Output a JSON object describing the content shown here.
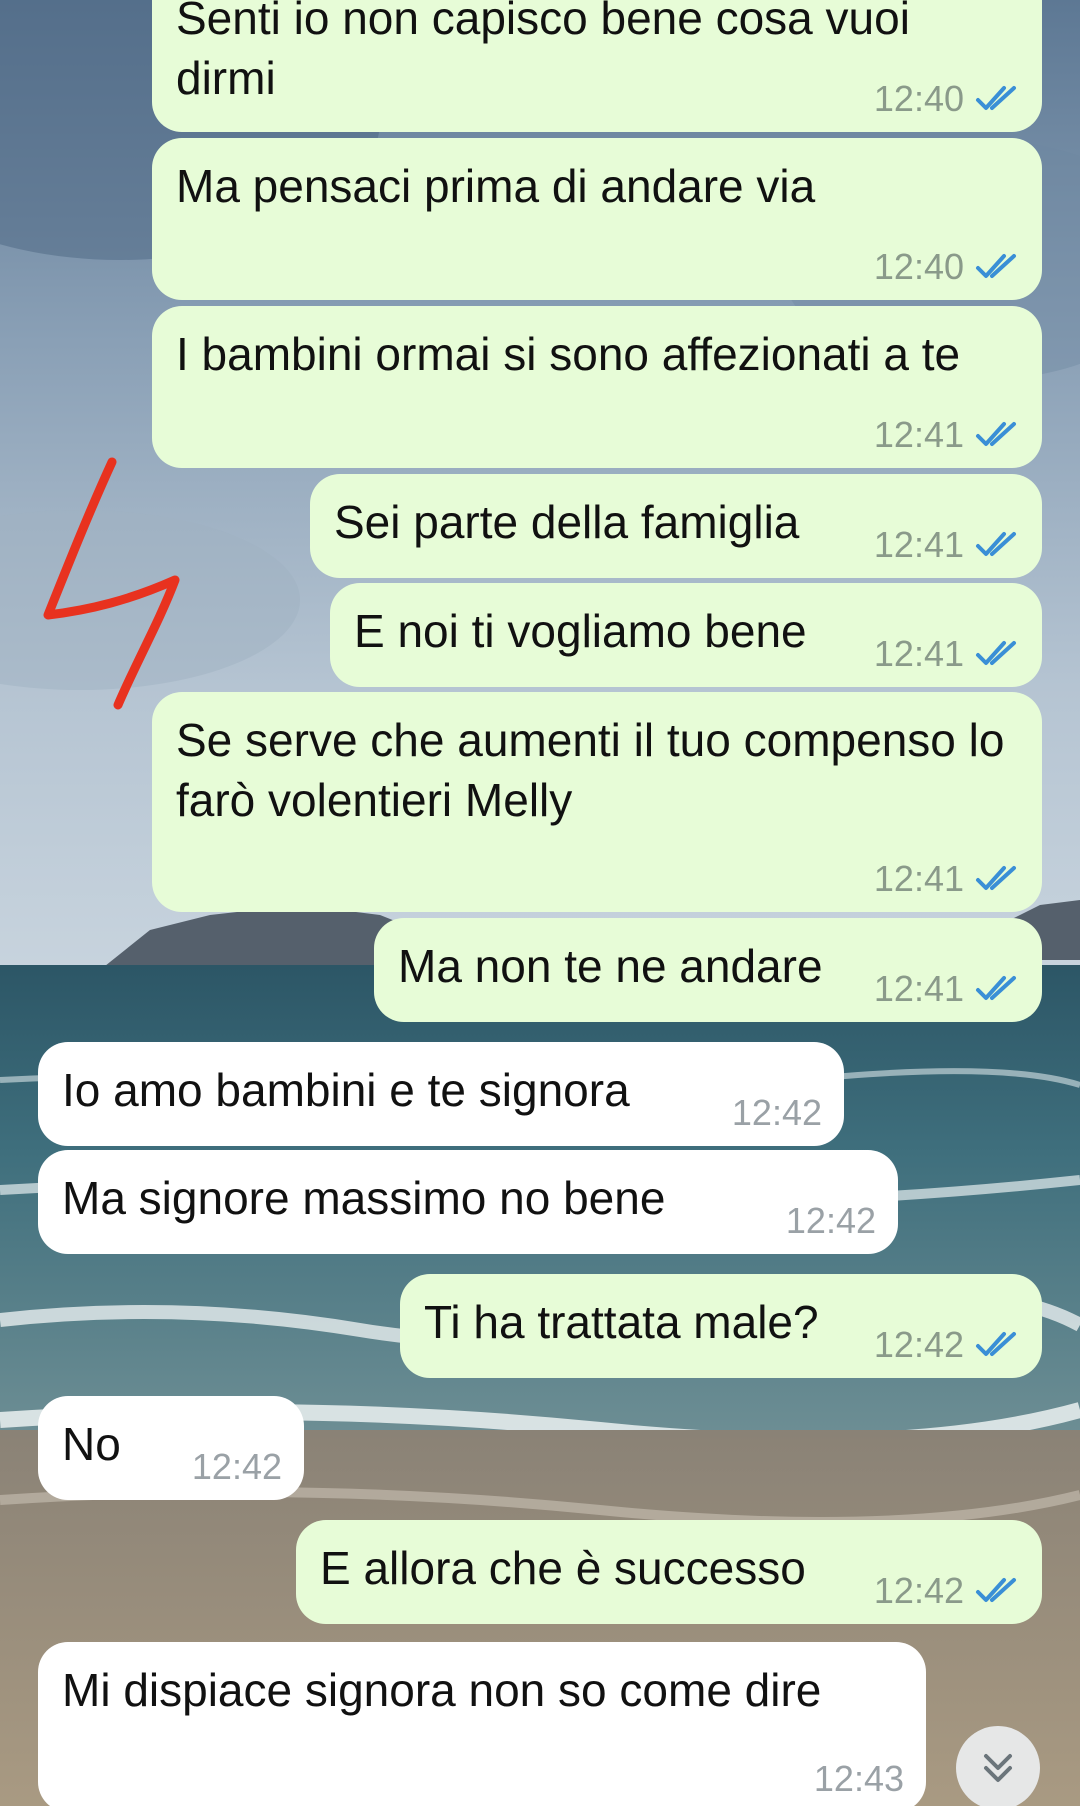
{
  "theme": {
    "outgoing_bubble": "#e7fcd7",
    "incoming_bubble": "#ffffff",
    "tick_color": "#3a8fd6",
    "annotation_color": "#e8321f"
  },
  "annotation": {
    "glyph": "4"
  },
  "messages": [
    {
      "dir": "out",
      "text": "Senti io non capisco bene cosa vuoi dirmi",
      "time": "12:40",
      "ticks": "double-check-icon"
    },
    {
      "dir": "out",
      "text": "Ma pensaci prima di andare via",
      "time": "12:40",
      "ticks": "double-check-icon"
    },
    {
      "dir": "out",
      "text": "I bambini ormai si sono affezionati a te",
      "time": "12:41",
      "ticks": "double-check-icon"
    },
    {
      "dir": "out",
      "text": "Sei parte della famiglia",
      "time": "12:41",
      "ticks": "double-check-icon"
    },
    {
      "dir": "out",
      "text": "E noi ti vogliamo bene",
      "time": "12:41",
      "ticks": "double-check-icon"
    },
    {
      "dir": "out",
      "text": "Se serve che aumenti il tuo compenso lo farò volentieri Melly",
      "time": "12:41",
      "ticks": "double-check-icon"
    },
    {
      "dir": "out",
      "text": "Ma non te ne andare",
      "time": "12:41",
      "ticks": "double-check-icon"
    },
    {
      "dir": "in",
      "text": "Io amo bambini e te signora",
      "time": "12:42"
    },
    {
      "dir": "in",
      "text": "Ma signore massimo no bene",
      "time": "12:42"
    },
    {
      "dir": "out",
      "text": "Ti ha trattata male?",
      "time": "12:42",
      "ticks": "double-check-icon"
    },
    {
      "dir": "in",
      "text": "No",
      "time": "12:42"
    },
    {
      "dir": "out",
      "text": "E allora che è successo",
      "time": "12:42",
      "ticks": "double-check-icon"
    },
    {
      "dir": "in",
      "text": "Mi dispiace signora non so come dire",
      "time": "12:43"
    }
  ],
  "scroll_button": {
    "icon": "double-chevron-down-icon"
  }
}
